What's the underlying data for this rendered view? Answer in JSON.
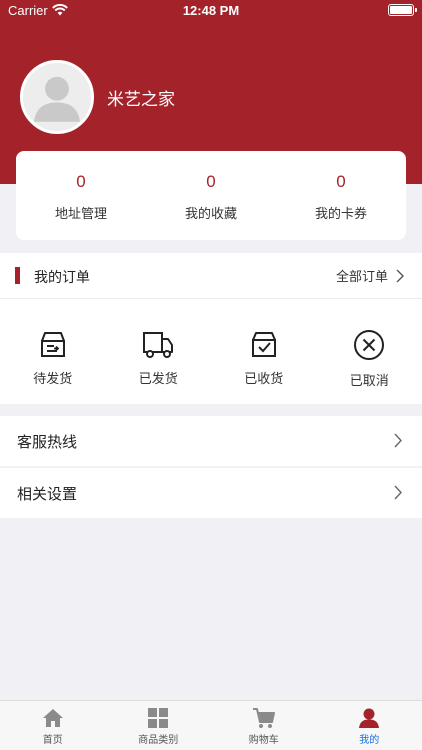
{
  "status_bar": {
    "carrier": "Carrier",
    "time": "12:48 PM"
  },
  "profile": {
    "username": "米艺之家"
  },
  "stats": [
    {
      "value": "0",
      "label": "地址管理"
    },
    {
      "value": "0",
      "label": "我的收藏"
    },
    {
      "value": "0",
      "label": "我的卡券"
    }
  ],
  "orders": {
    "title": "我的订单",
    "all_label": "全部订单",
    "items": [
      {
        "label": "待发货",
        "icon": "pending-shipment-icon"
      },
      {
        "label": "已发货",
        "icon": "truck-icon"
      },
      {
        "label": "已收货",
        "icon": "received-box-icon"
      },
      {
        "label": "已取消",
        "icon": "cancel-circle-icon"
      }
    ]
  },
  "menu": [
    {
      "label": "客服热线"
    },
    {
      "label": "相关设置"
    }
  ],
  "tabbar": [
    {
      "label": "首页",
      "icon": "home-icon"
    },
    {
      "label": "商品类别",
      "icon": "grid-icon"
    },
    {
      "label": "购物车",
      "icon": "cart-icon"
    },
    {
      "label": "我的",
      "icon": "user-icon",
      "active": true
    }
  ],
  "colors": {
    "brand": "#a4232b",
    "active_tab": "#1a6fd9",
    "background": "#f1f1f5"
  }
}
